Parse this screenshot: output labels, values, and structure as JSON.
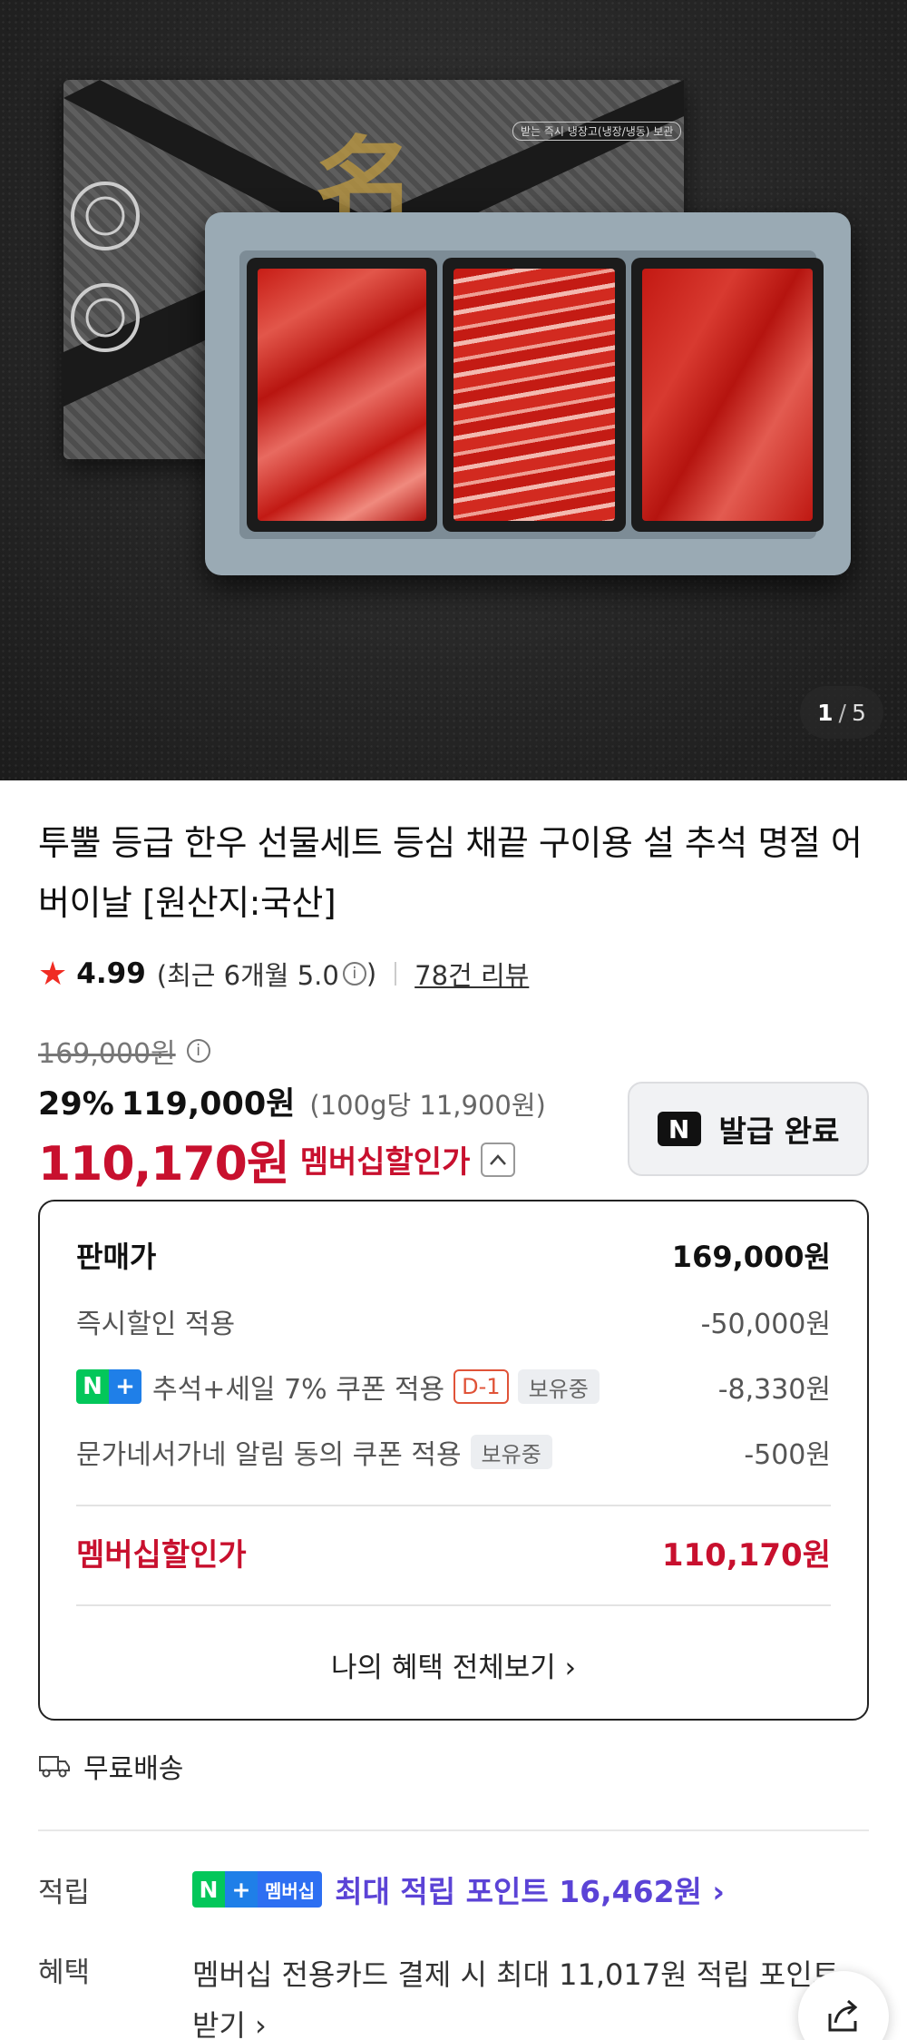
{
  "gallery": {
    "current": "1",
    "separator": "/",
    "total": "5",
    "lid_label": "받는 즉시 냉장고(냉장/냉동) 보관",
    "lid_hanja": "名"
  },
  "product": {
    "title": "투뿔 등급 한우 선물세트 등심 채끝 구이용 설 추석 명절 어버이날 [원산지:국산]",
    "rating": "4.99",
    "rating_recent_prefix": "(최근 6개월 5.0",
    "rating_recent_suffix": ")",
    "review_link": "78건 리뷰",
    "original_price": "169,000원",
    "discount_rate": "29%",
    "discount_price": "119,000원",
    "unit_price": "(100g당 11,900원)",
    "member_price": "110,170원",
    "member_label": "멤버십할인가",
    "coupon_button": "발급 완료",
    "coupon_logo": "N"
  },
  "breakdown": {
    "sale_label": "판매가",
    "sale_value": "169,000원",
    "instant_label": "즉시할인 적용",
    "instant_value": "-50,000원",
    "np_n": "N",
    "np_plus": "+",
    "coupon_label": "추석+세일 7% 쿠폰 적용",
    "coupon_dday": "D-1",
    "coupon_hold": "보유중",
    "coupon_value": "-8,330원",
    "alarm_label": "문가네서가네 알림 동의 쿠폰 적용",
    "alarm_hold": "보유중",
    "alarm_value": "-500원",
    "member_label": "멤버십할인가",
    "member_value": "110,170원",
    "view_all": "나의 혜택 전체보기 ›"
  },
  "shipping": {
    "label": "무료배송"
  },
  "points": {
    "label": "적립",
    "badge_n": "N",
    "badge_plus": "+",
    "badge_member": "멤버십",
    "text": "최대 적립 포인트 16,462원 ›"
  },
  "benefit": {
    "label": "혜택",
    "text": "멤버십 전용카드 결제 시 최대 11,017원 적립 포인트 받기 ›"
  },
  "colors": {
    "accent_red": "#c8102e",
    "naver_green": "#03c75a",
    "points_purple": "#5b43d6"
  }
}
